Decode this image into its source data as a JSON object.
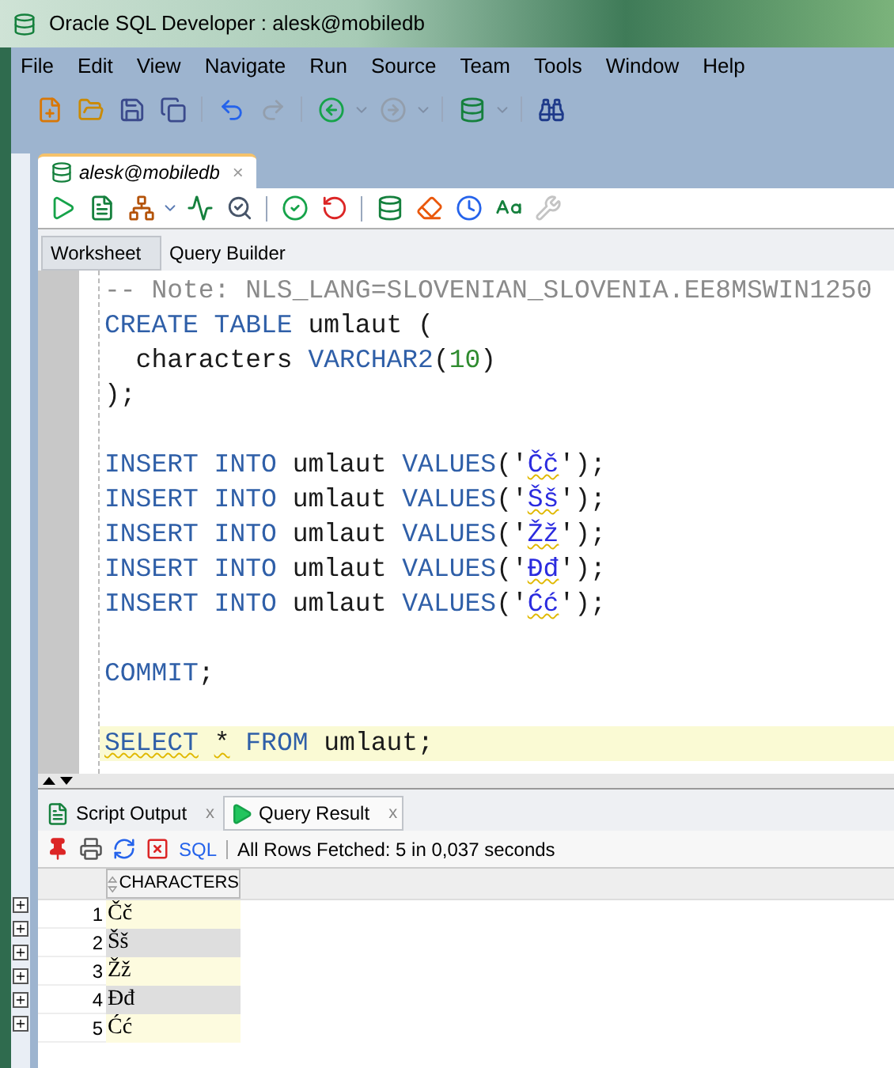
{
  "window": {
    "title": "Oracle SQL Developer : alesk@mobiledb"
  },
  "menu": [
    "File",
    "Edit",
    "View",
    "Navigate",
    "Run",
    "Source",
    "Team",
    "Tools",
    "Window",
    "Help"
  ],
  "toolbar": [
    {
      "kind": "new",
      "disabled": false
    },
    {
      "kind": "open",
      "disabled": false
    },
    {
      "kind": "save",
      "disabled": false
    },
    {
      "kind": "save_all",
      "disabled": false
    },
    {
      "kind": "sep"
    },
    {
      "kind": "undo",
      "disabled": false
    },
    {
      "kind": "redo",
      "disabled": true
    },
    {
      "kind": "sep"
    },
    {
      "kind": "back",
      "disabled": false
    },
    {
      "kind": "forward",
      "disabled": true
    },
    {
      "kind": "sep"
    },
    {
      "kind": "sql",
      "disabled": false
    },
    {
      "kind": "sep"
    },
    {
      "kind": "find",
      "disabled": false
    }
  ],
  "document_tab": {
    "label": "alesk@mobiledb",
    "close": "×"
  },
  "editor_toolbar": [
    {
      "kind": "run",
      "disabled": false
    },
    {
      "kind": "script",
      "disabled": false
    },
    {
      "kind": "explain",
      "disabled": false
    },
    {
      "kind": "autotrace",
      "disabled": false
    },
    {
      "kind": "monitor",
      "disabled": false
    },
    {
      "kind": "sep"
    },
    {
      "kind": "commit",
      "disabled": false
    },
    {
      "kind": "rollback",
      "disabled": false
    },
    {
      "kind": "sep"
    },
    {
      "kind": "sql",
      "disabled": false
    },
    {
      "kind": "clear",
      "disabled": false
    },
    {
      "kind": "history",
      "disabled": false
    },
    {
      "kind": "case",
      "disabled": false
    },
    {
      "kind": "tools",
      "disabled": true
    }
  ],
  "worksheet_tabs": [
    {
      "label": "Worksheet",
      "selected": true
    },
    {
      "label": "Query Builder",
      "selected": false
    }
  ],
  "code_lines": [
    {
      "current": false,
      "tokens": [
        {
          "text": "-- Note: NLS_LANG=SLOVENIAN_SLOVENIA.EE8MSWIN1250",
          "kind": "comment",
          "flagged": false
        }
      ]
    },
    {
      "current": false,
      "tokens": [
        {
          "text": "CREATE TABLE",
          "kind": "keyword",
          "flagged": false
        },
        {
          "text": " umlaut (",
          "kind": "plain",
          "flagged": false
        }
      ]
    },
    {
      "current": false,
      "tokens": [
        {
          "text": "  characters ",
          "kind": "plain",
          "flagged": false
        },
        {
          "text": "VARCHAR2",
          "kind": "keyword",
          "flagged": false
        },
        {
          "text": "(",
          "kind": "plain",
          "flagged": false
        },
        {
          "text": "10",
          "kind": "number",
          "flagged": false
        },
        {
          "text": ")",
          "kind": "plain",
          "flagged": false
        }
      ]
    },
    {
      "current": false,
      "tokens": [
        {
          "text": ");",
          "kind": "plain",
          "flagged": false
        }
      ]
    },
    {
      "current": false
    },
    {
      "current": false,
      "tokens": [
        {
          "text": "INSERT INTO",
          "kind": "keyword",
          "flagged": false
        },
        {
          "text": " umlaut ",
          "kind": "plain",
          "flagged": false
        },
        {
          "text": "VALUES",
          "kind": "keyword",
          "flagged": false
        },
        {
          "text": "('",
          "kind": "plain",
          "flagged": false
        },
        {
          "text": "Čč",
          "kind": "string",
          "flagged": true
        },
        {
          "text": "');",
          "kind": "plain",
          "flagged": false
        }
      ]
    },
    {
      "current": false,
      "tokens": [
        {
          "text": "INSERT INTO",
          "kind": "keyword",
          "flagged": false
        },
        {
          "text": " umlaut ",
          "kind": "plain",
          "flagged": false
        },
        {
          "text": "VALUES",
          "kind": "keyword",
          "flagged": false
        },
        {
          "text": "('",
          "kind": "plain",
          "flagged": false
        },
        {
          "text": "Šš",
          "kind": "string",
          "flagged": true
        },
        {
          "text": "');",
          "kind": "plain",
          "flagged": false
        }
      ]
    },
    {
      "current": false,
      "tokens": [
        {
          "text": "INSERT INTO",
          "kind": "keyword",
          "flagged": false
        },
        {
          "text": " umlaut ",
          "kind": "plain",
          "flagged": false
        },
        {
          "text": "VALUES",
          "kind": "keyword",
          "flagged": false
        },
        {
          "text": "('",
          "kind": "plain",
          "flagged": false
        },
        {
          "text": "Žž",
          "kind": "string",
          "flagged": true
        },
        {
          "text": "');",
          "kind": "plain",
          "flagged": false
        }
      ]
    },
    {
      "current": false,
      "tokens": [
        {
          "text": "INSERT INTO",
          "kind": "keyword",
          "flagged": false
        },
        {
          "text": " umlaut ",
          "kind": "plain",
          "flagged": false
        },
        {
          "text": "VALUES",
          "kind": "keyword",
          "flagged": false
        },
        {
          "text": "('",
          "kind": "plain",
          "flagged": false
        },
        {
          "text": "Đđ",
          "kind": "string",
          "flagged": true
        },
        {
          "text": "');",
          "kind": "plain",
          "flagged": false
        }
      ]
    },
    {
      "current": false,
      "tokens": [
        {
          "text": "INSERT INTO",
          "kind": "keyword",
          "flagged": false
        },
        {
          "text": " umlaut ",
          "kind": "plain",
          "flagged": false
        },
        {
          "text": "VALUES",
          "kind": "keyword",
          "flagged": false
        },
        {
          "text": "('",
          "kind": "plain",
          "flagged": false
        },
        {
          "text": "Ćć",
          "kind": "string",
          "flagged": true
        },
        {
          "text": "');",
          "kind": "plain",
          "flagged": false
        }
      ]
    },
    {
      "current": false
    },
    {
      "current": false,
      "tokens": [
        {
          "text": "COMMIT",
          "kind": "keyword",
          "flagged": false
        },
        {
          "text": ";",
          "kind": "plain",
          "flagged": false
        }
      ]
    },
    {
      "current": false
    },
    {
      "current": true,
      "tokens": [
        {
          "text": "SELECT",
          "kind": "keyword",
          "flagged": true
        },
        {
          "text": "*",
          "kind": "plain",
          "flagged": true,
          "space_before": true
        },
        {
          "text": " FROM",
          "kind": "keyword",
          "flagged": false
        },
        {
          "text": " umlaut;",
          "kind": "plain",
          "flagged": false
        }
      ]
    }
  ],
  "result_tabs": [
    {
      "label": "Script Output",
      "kind": "script",
      "close": "x",
      "selected": false
    },
    {
      "label": "Query Result",
      "kind": "query",
      "close": "x",
      "selected": true
    }
  ],
  "result_toolbar": {
    "sql_link": "SQL",
    "status": "All Rows Fetched: 5 in 0,037 seconds"
  },
  "grid": {
    "columns": [
      "CHARACTERS"
    ],
    "rows": [
      {
        "number": "1",
        "cells": [
          "Čč"
        ]
      },
      {
        "number": "2",
        "cells": [
          "Šš"
        ]
      },
      {
        "number": "3",
        "cells": [
          "Žž"
        ]
      },
      {
        "number": "4",
        "cells": [
          "Đđ"
        ]
      },
      {
        "number": "5",
        "cells": [
          "Ćć"
        ]
      }
    ]
  }
}
